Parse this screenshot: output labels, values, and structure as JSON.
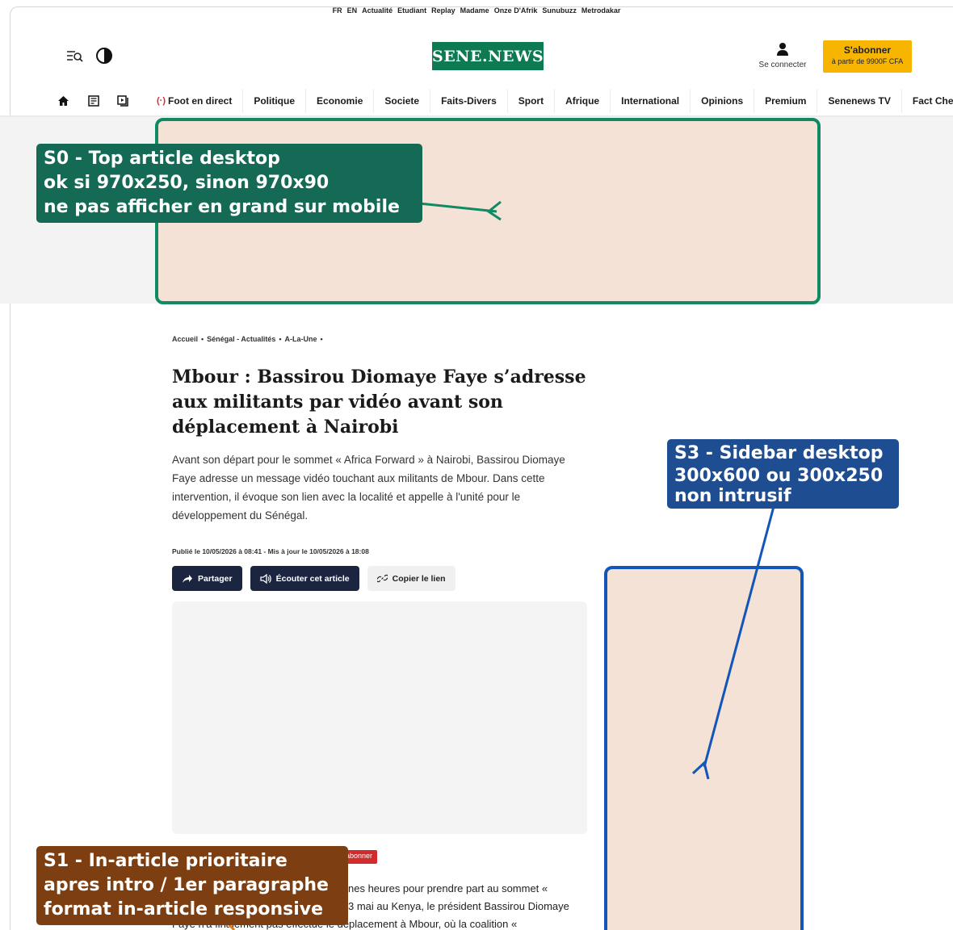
{
  "langbar": {
    "links": [
      "FR",
      "EN",
      "Actualité",
      "Etudiant",
      "Replay",
      "Madame",
      "Onze D'Afrik",
      "Sunubuzz",
      "Metrodakar"
    ]
  },
  "header": {
    "logo": "SENE.NEWS",
    "login_label": "Se connecter",
    "subscribe_title": "S'abonner",
    "subscribe_sub": "à partir de 9900F CFA"
  },
  "nav": {
    "live_label": "Foot en direct",
    "items": [
      "Politique",
      "Economie",
      "Societe",
      "Faits-Divers",
      "Sport",
      "Afrique",
      "International",
      "Opinions",
      "Premium",
      "Senenews TV",
      "Fact Checking"
    ]
  },
  "annotations": {
    "s0": [
      "S0 - Top article desktop",
      "ok si 970x250, sinon 970x90",
      "ne pas afficher en grand sur mobile"
    ],
    "s3": [
      "S3 - Sidebar desktop",
      "300x600 ou 300x250",
      "non intrusif"
    ],
    "s1": [
      "S1 - In-article prioritaire",
      "apres intro / 1er paragraphe",
      "format in-article responsive"
    ],
    "colors": {
      "s0": "#118a63",
      "s3": "#1156b8",
      "s1": "#e07a1a"
    }
  },
  "article": {
    "breadcrumb": [
      "Accueil",
      "•",
      "Sénégal - Actualités",
      "•",
      "A-La-Une",
      "•"
    ],
    "title": "Mbour : Bassirou Diomaye Faye s’adresse aux militants par vidéo avant son déplacement à Nairobi",
    "intro": "Avant son départ pour le sommet « Africa Forward » à Nairobi, Bassirou Diomaye Faye adresse un message vidéo touchant aux militants de Mbour. Dans cette intervention, il évoque son lien avec la localité et appelle à l'unité pour le développement du Sénégal.",
    "meta": "Publié le 10/05/2026 à 08:41 - Mis à jour le 10/05/2026 à 18:08",
    "share_label": "Partager",
    "listen_label": "Écouter cet article",
    "copy_label": "Copier le lien",
    "tag_label": "abonner",
    "body_lines": [
      "nes heures pour prendre part au sommet «",
      "3 mai au Kenya, le président Bassirou Diomaye",
      "Faye n'a finalement pas effectué le déplacement à Mbour, où la coalition «"
    ]
  }
}
